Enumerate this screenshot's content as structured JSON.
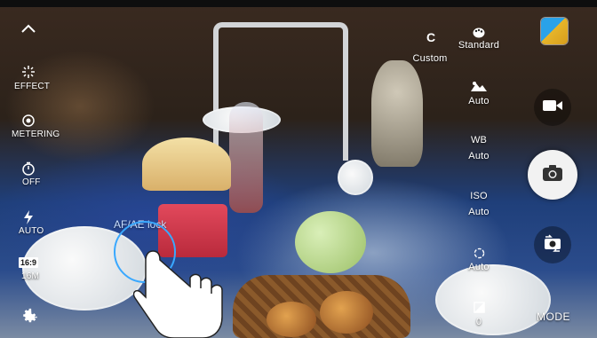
{
  "left_controls": {
    "effect_label": "EFFECT",
    "metering_label": "METERING",
    "timer_label": "OFF",
    "flash_label": "AUTO",
    "ratio_badge": "16:9",
    "resolution_label": "16M"
  },
  "right_settings": {
    "custom_letter": "C",
    "custom_label": "Custom",
    "standard_label": "Standard",
    "hdr_value": "Auto",
    "wb_label": "WB",
    "wb_value": "Auto",
    "iso_label": "ISO",
    "iso_value": "Auto",
    "shutter_speed_value": "Auto",
    "exposure_value": "0"
  },
  "focus": {
    "af_ae_lock_label": "AF/AE lock"
  },
  "mode": {
    "label": "MODE"
  },
  "colors": {
    "focus_ring": "#39a8ff",
    "shutter_button": "#f2f2f2"
  },
  "icons": {
    "collapse": "chevron-up-icon",
    "effect": "sparkle-icon",
    "metering": "metering-icon",
    "timer": "timer-icon",
    "flash": "flash-icon",
    "settings": "gear-icon",
    "video": "video-camera-icon",
    "capture": "camera-icon",
    "switch_camera": "switch-camera-icon",
    "custom_palette": "palette-icon",
    "hdr": "hdr-icon",
    "shutter_speed": "aperture-icon",
    "exposure": "exposure-icon",
    "gesture": "tap-hand-icon"
  }
}
